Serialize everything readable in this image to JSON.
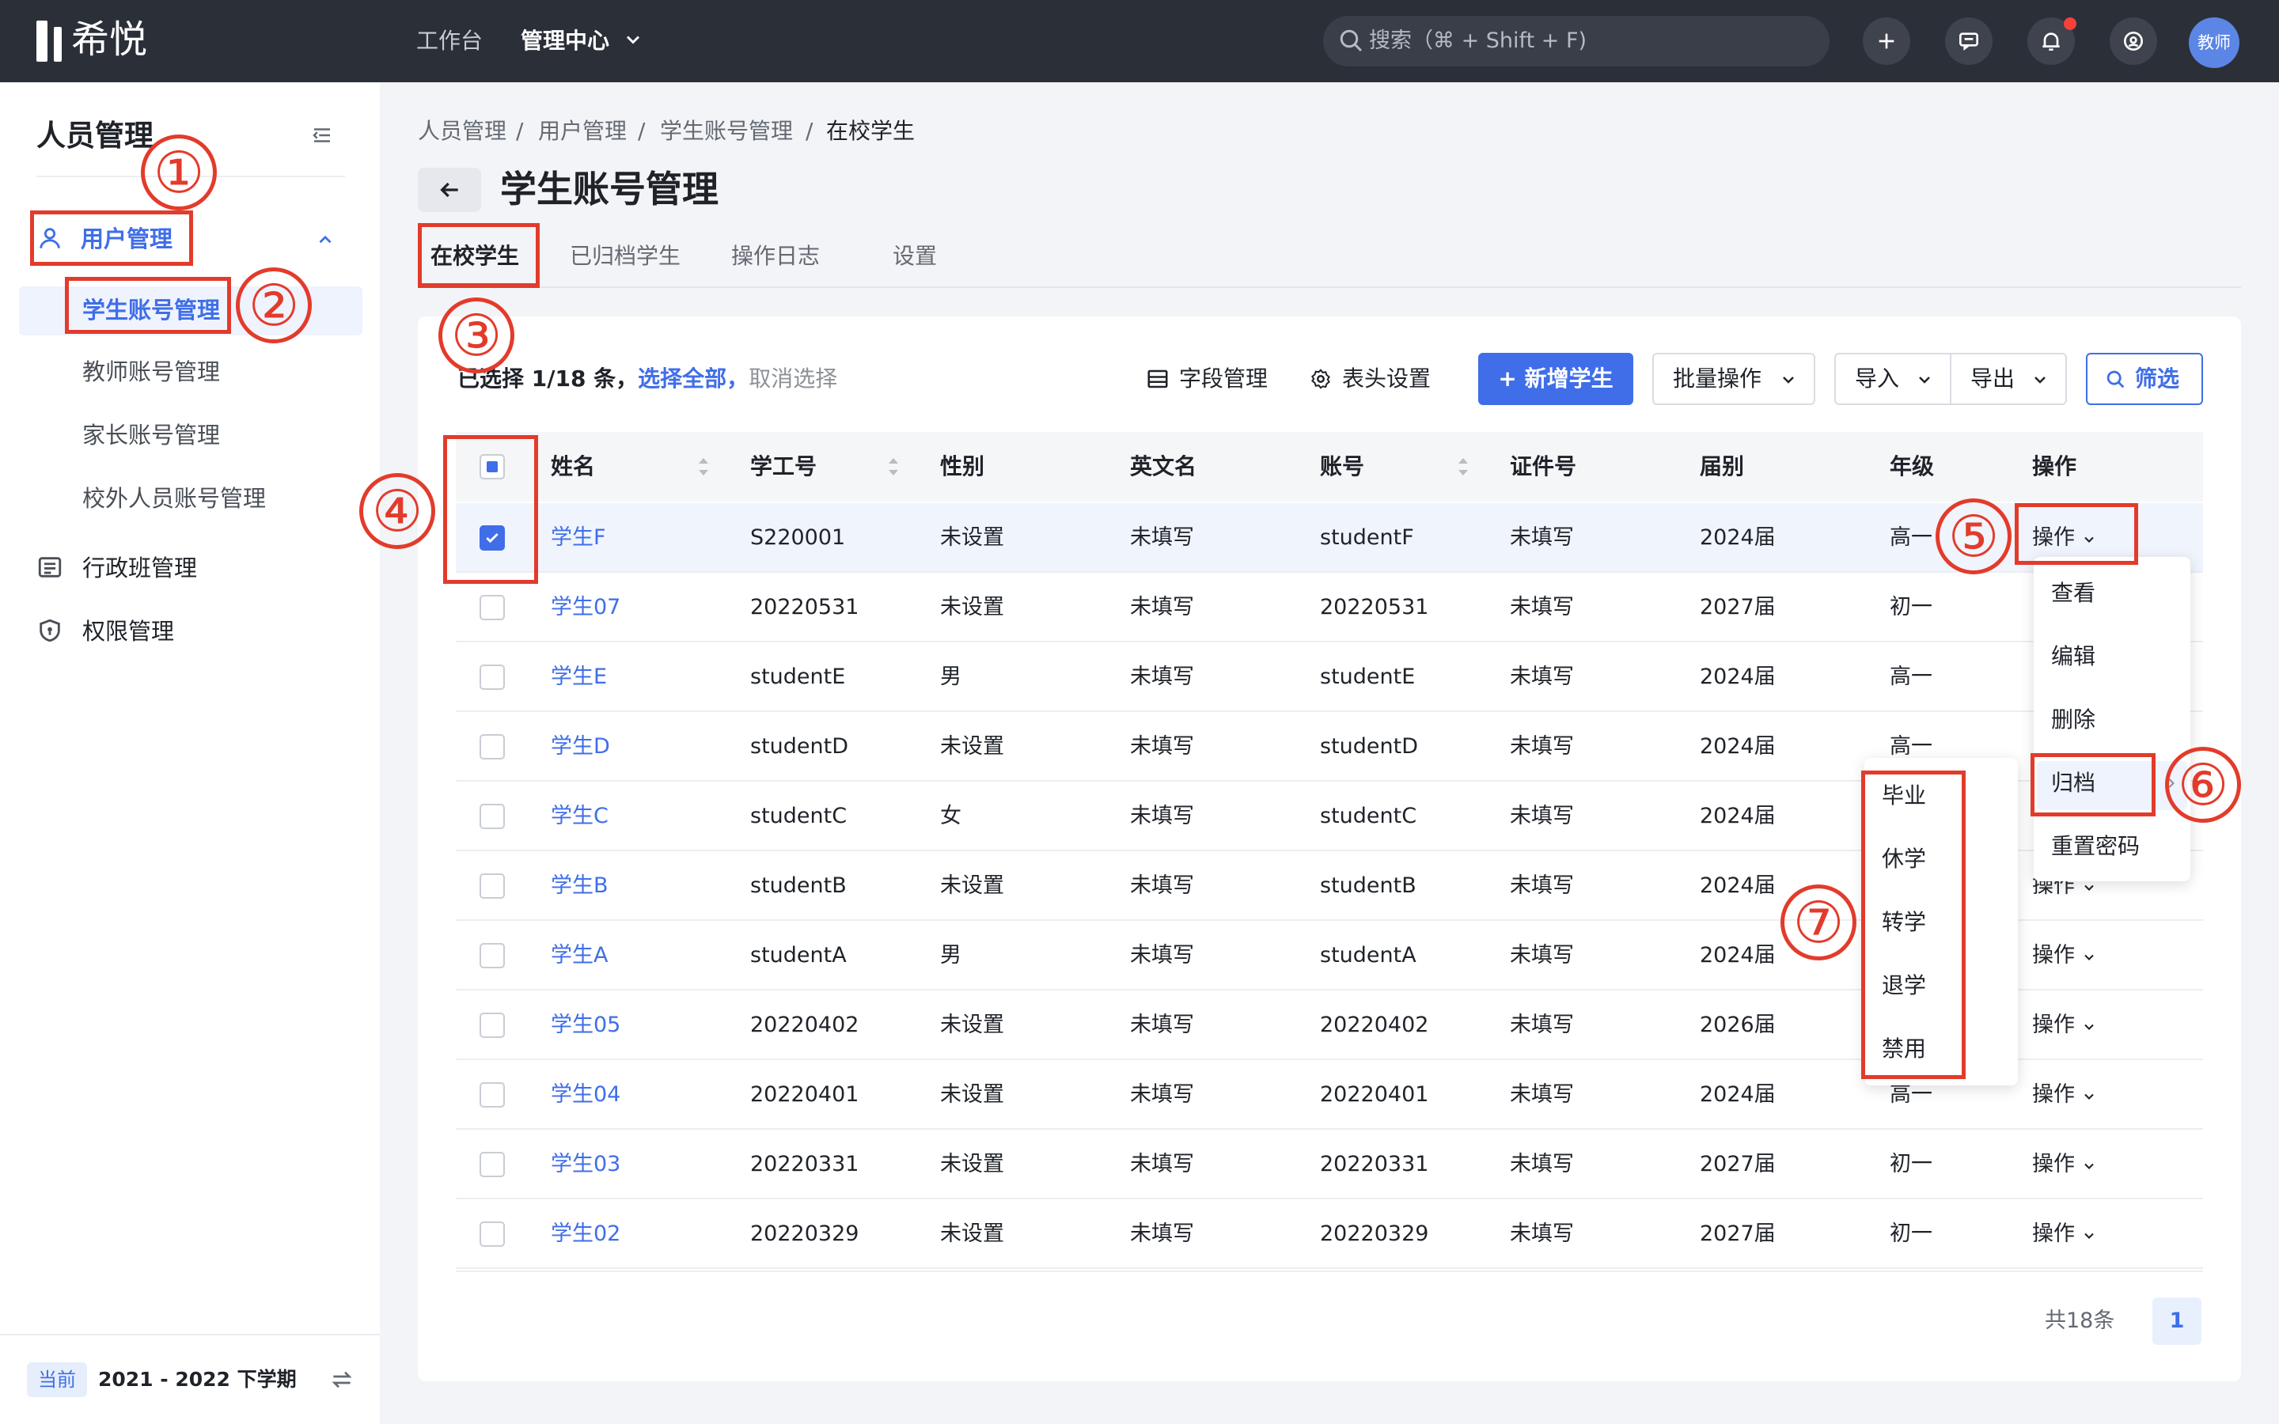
{
  "app": {
    "logo": "希悦"
  },
  "topbar": {
    "nav": [
      "工作台",
      "管理中心"
    ],
    "search_placeholder": "搜索（⌘ + Shift + F)",
    "avatar": "教师",
    "icons": [
      "plus-icon",
      "message-icon",
      "bell-icon",
      "help-icon"
    ]
  },
  "sidebar": {
    "title": "人员管理",
    "user_mgmt": "用户管理",
    "sub_items": [
      "学生账号管理",
      "教师账号管理",
      "家长账号管理",
      "校外人员账号管理"
    ],
    "class_mgmt": "行政班管理",
    "perm_mgmt": "权限管理",
    "semester_badge": "当前",
    "semester": "2021 - 2022 下学期"
  },
  "breadcrumb": [
    "人员管理",
    "/",
    "用户管理",
    "/",
    "学生账号管理",
    "/",
    "在校学生"
  ],
  "page": {
    "title": "学生账号管理",
    "tabs": [
      "在校学生",
      "已归档学生",
      "操作日志",
      "设置"
    ]
  },
  "toolbar": {
    "selected": "已选择 1/18 条，",
    "select_all": "选择全部，",
    "cancel": "取消选择",
    "field_mgmt": "字段管理",
    "header_settings": "表头设置",
    "add_student": "+ 新增学生",
    "batch": "批量操作",
    "import": "导入",
    "export": "导出",
    "filter": "筛选"
  },
  "table": {
    "columns": [
      "姓名",
      "学工号",
      "性别",
      "英文名",
      "账号",
      "证件号",
      "届别",
      "年级",
      "操作"
    ],
    "rows": [
      {
        "name": "学生F",
        "id": "S220001",
        "gender": "未设置",
        "en": "未填写",
        "account": "studentF",
        "cert": "未填写",
        "cohort": "2024届",
        "grade": "高一",
        "checked": true
      },
      {
        "name": "学生07",
        "id": "20220531",
        "gender": "未设置",
        "en": "未填写",
        "account": "20220531",
        "cert": "未填写",
        "cohort": "2027届",
        "grade": "初一",
        "checked": false
      },
      {
        "name": "学生E",
        "id": "studentE",
        "gender": "男",
        "en": "未填写",
        "account": "studentE",
        "cert": "未填写",
        "cohort": "2024届",
        "grade": "高一",
        "checked": false
      },
      {
        "name": "学生D",
        "id": "studentD",
        "gender": "未设置",
        "en": "未填写",
        "account": "studentD",
        "cert": "未填写",
        "cohort": "2024届",
        "grade": "高一",
        "checked": false
      },
      {
        "name": "学生C",
        "id": "studentC",
        "gender": "女",
        "en": "未填写",
        "account": "studentC",
        "cert": "未填写",
        "cohort": "2024届",
        "grade": "",
        "checked": false
      },
      {
        "name": "学生B",
        "id": "studentB",
        "gender": "未设置",
        "en": "未填写",
        "account": "studentB",
        "cert": "未填写",
        "cohort": "2024届",
        "grade": "",
        "checked": false
      },
      {
        "name": "学生A",
        "id": "studentA",
        "gender": "男",
        "en": "未填写",
        "account": "studentA",
        "cert": "未填写",
        "cohort": "2024届",
        "grade": "",
        "checked": false
      },
      {
        "name": "学生05",
        "id": "20220402",
        "gender": "未设置",
        "en": "未填写",
        "account": "20220402",
        "cert": "未填写",
        "cohort": "2026届",
        "grade": "",
        "checked": false
      },
      {
        "name": "学生04",
        "id": "20220401",
        "gender": "未设置",
        "en": "未填写",
        "account": "20220401",
        "cert": "未填写",
        "cohort": "2024届",
        "grade": "高一",
        "checked": false
      },
      {
        "name": "学生03",
        "id": "20220331",
        "gender": "未设置",
        "en": "未填写",
        "account": "20220331",
        "cert": "未填写",
        "cohort": "2027届",
        "grade": "初一",
        "checked": false
      },
      {
        "name": "学生02",
        "id": "20220329",
        "gender": "未设置",
        "en": "未填写",
        "account": "20220329",
        "cert": "未填写",
        "cohort": "2027届",
        "grade": "初一",
        "checked": false
      }
    ],
    "op_label": "操作"
  },
  "op_menu": [
    "查看",
    "编辑",
    "删除",
    "归档",
    "重置密码"
  ],
  "archive_menu": [
    "毕业",
    "休学",
    "转学",
    "退学",
    "禁用"
  ],
  "pagination": {
    "total": "共18条",
    "page": "1"
  },
  "annotations": [
    "①",
    "②",
    "③",
    "④",
    "⑤",
    "⑥",
    "⑦"
  ],
  "colors": {
    "accent": "#3f6ee8",
    "annotation": "#e33b2b",
    "topbar": "#2b2f38"
  }
}
